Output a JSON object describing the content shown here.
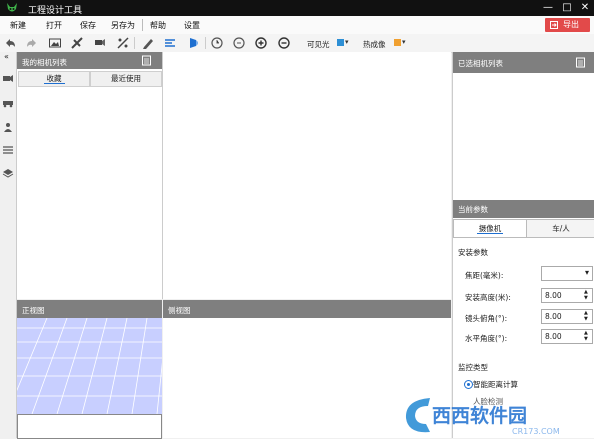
{
  "app": {
    "title": "工程设计工具"
  },
  "window_controls": [
    "—",
    "□",
    "✕"
  ],
  "menu": {
    "new": "新建",
    "open": "打开",
    "save": "保存",
    "save_as": "另存为",
    "help": "帮助",
    "settings": "设置",
    "export": "导出"
  },
  "toolbar": {
    "visible_light": "可见光",
    "thermal": "热成像",
    "visible_color": "#2d8fd5",
    "thermal_color": "#f0a030"
  },
  "left_collapse": "«",
  "camera_panel": {
    "title": "我的相机列表",
    "tab_favorites": "收藏",
    "tab_recent": "最近使用"
  },
  "front_view": {
    "title": "正视图"
  },
  "side_view": {
    "title": "侧视图"
  },
  "selected_panel": {
    "title": "已选相机列表"
  },
  "params": {
    "title": "当前参数",
    "tab_camera": "摄像机",
    "tab_vehicle": "车/人",
    "install_title": "安装参数",
    "focal_label": "焦距(毫米):",
    "focal_value": "",
    "height_label": "安装高度(米):",
    "height_value": "8.00",
    "tilt_label": "镜头俯角(°):",
    "tilt_value": "8.00",
    "pan_label": "水平角度(°):",
    "pan_value": "8.00",
    "monitor_type": "监控类型",
    "smart_distance": "智能距离计算",
    "face_detect": "人脸检测"
  },
  "watermark": {
    "brand": "西西软件园",
    "site": "CR173.COM"
  },
  "colors": {
    "export": "#e24a4a",
    "panel_header": "#7f7f7f",
    "active_tab": "#1e6fd0",
    "grid": "#c8cfff"
  }
}
